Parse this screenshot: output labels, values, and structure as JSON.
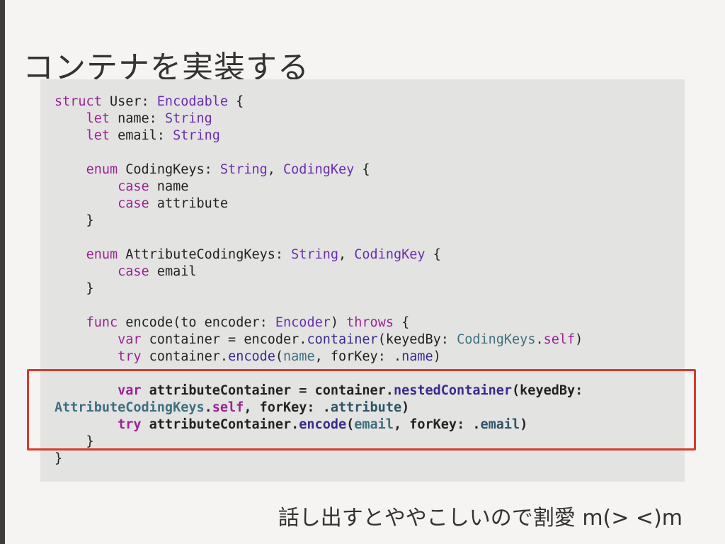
{
  "slide": {
    "title": "コンテナを実装する",
    "caption": "話し出すとややこしいので割愛 m(> <)m"
  },
  "colors": {
    "keyword": "#9b2393",
    "type": "#6a2db0",
    "method": "#3a2a8c",
    "property": "#3e6f7e",
    "highlight_border": "#d83a2a"
  },
  "code": {
    "lines": [
      [
        {
          "t": "struct",
          "c": "kw"
        },
        {
          "t": " User: "
        },
        {
          "t": "Encodable",
          "c": "ty"
        },
        {
          "t": " {"
        }
      ],
      [
        {
          "t": "    "
        },
        {
          "t": "let",
          "c": "kw"
        },
        {
          "t": " name: "
        },
        {
          "t": "String",
          "c": "ty"
        }
      ],
      [
        {
          "t": "    "
        },
        {
          "t": "let",
          "c": "kw"
        },
        {
          "t": " email: "
        },
        {
          "t": "String",
          "c": "ty"
        }
      ],
      [],
      [
        {
          "t": "    "
        },
        {
          "t": "enum",
          "c": "kw"
        },
        {
          "t": " CodingKeys: "
        },
        {
          "t": "String",
          "c": "ty"
        },
        {
          "t": ", "
        },
        {
          "t": "CodingKey",
          "c": "ty"
        },
        {
          "t": " {"
        }
      ],
      [
        {
          "t": "        "
        },
        {
          "t": "case",
          "c": "kw"
        },
        {
          "t": " name"
        }
      ],
      [
        {
          "t": "        "
        },
        {
          "t": "case",
          "c": "kw"
        },
        {
          "t": " attribute"
        }
      ],
      [
        {
          "t": "    }"
        }
      ],
      [],
      [
        {
          "t": "    "
        },
        {
          "t": "enum",
          "c": "kw"
        },
        {
          "t": " AttributeCodingKeys: "
        },
        {
          "t": "String",
          "c": "ty"
        },
        {
          "t": ", "
        },
        {
          "t": "CodingKey",
          "c": "ty"
        },
        {
          "t": " {"
        }
      ],
      [
        {
          "t": "        "
        },
        {
          "t": "case",
          "c": "kw"
        },
        {
          "t": " email"
        }
      ],
      [
        {
          "t": "    }"
        }
      ],
      [],
      [
        {
          "t": "    "
        },
        {
          "t": "func",
          "c": "kw"
        },
        {
          "t": " encode(to encoder: "
        },
        {
          "t": "Encoder",
          "c": "ty"
        },
        {
          "t": ") "
        },
        {
          "t": "throws",
          "c": "kw"
        },
        {
          "t": " {"
        }
      ],
      [
        {
          "t": "        "
        },
        {
          "t": "var",
          "c": "kw"
        },
        {
          "t": " container = encoder."
        },
        {
          "t": "container",
          "c": "fn"
        },
        {
          "t": "(keyedBy: "
        },
        {
          "t": "CodingKeys",
          "c": "pr"
        },
        {
          "t": "."
        },
        {
          "t": "self",
          "c": "kw"
        },
        {
          "t": ")"
        }
      ],
      [
        {
          "t": "        "
        },
        {
          "t": "try",
          "c": "kw"
        },
        {
          "t": " container."
        },
        {
          "t": "encode",
          "c": "fn"
        },
        {
          "t": "("
        },
        {
          "t": "name",
          "c": "pr"
        },
        {
          "t": ", forKey: ."
        },
        {
          "t": "name",
          "c": "fn"
        },
        {
          "t": ")"
        }
      ],
      [],
      {
        "bold": true,
        "tokens": [
          {
            "t": "        "
          },
          {
            "t": "var",
            "c": "kw"
          },
          {
            "t": " attributeContainer = container."
          },
          {
            "t": "nestedContainer",
            "c": "fn"
          },
          {
            "t": "(keyedBy:"
          }
        ]
      },
      {
        "bold": true,
        "tokens": [
          {
            "t": "AttributeCodingKeys",
            "c": "pr"
          },
          {
            "t": "."
          },
          {
            "t": "self",
            "c": "kw"
          },
          {
            "t": ", forKey: ."
          },
          {
            "t": "attribute",
            "c": "dt"
          },
          {
            "t": ")"
          }
        ]
      },
      {
        "bold": true,
        "tokens": [
          {
            "t": "        "
          },
          {
            "t": "try",
            "c": "kw"
          },
          {
            "t": " attributeContainer."
          },
          {
            "t": "encode",
            "c": "fn"
          },
          {
            "t": "("
          },
          {
            "t": "email",
            "c": "pr"
          },
          {
            "t": ", forKey: ."
          },
          {
            "t": "email",
            "c": "dt"
          },
          {
            "t": ")"
          }
        ]
      },
      [
        {
          "t": "    }"
        }
      ],
      [
        {
          "t": "}"
        }
      ]
    ]
  }
}
